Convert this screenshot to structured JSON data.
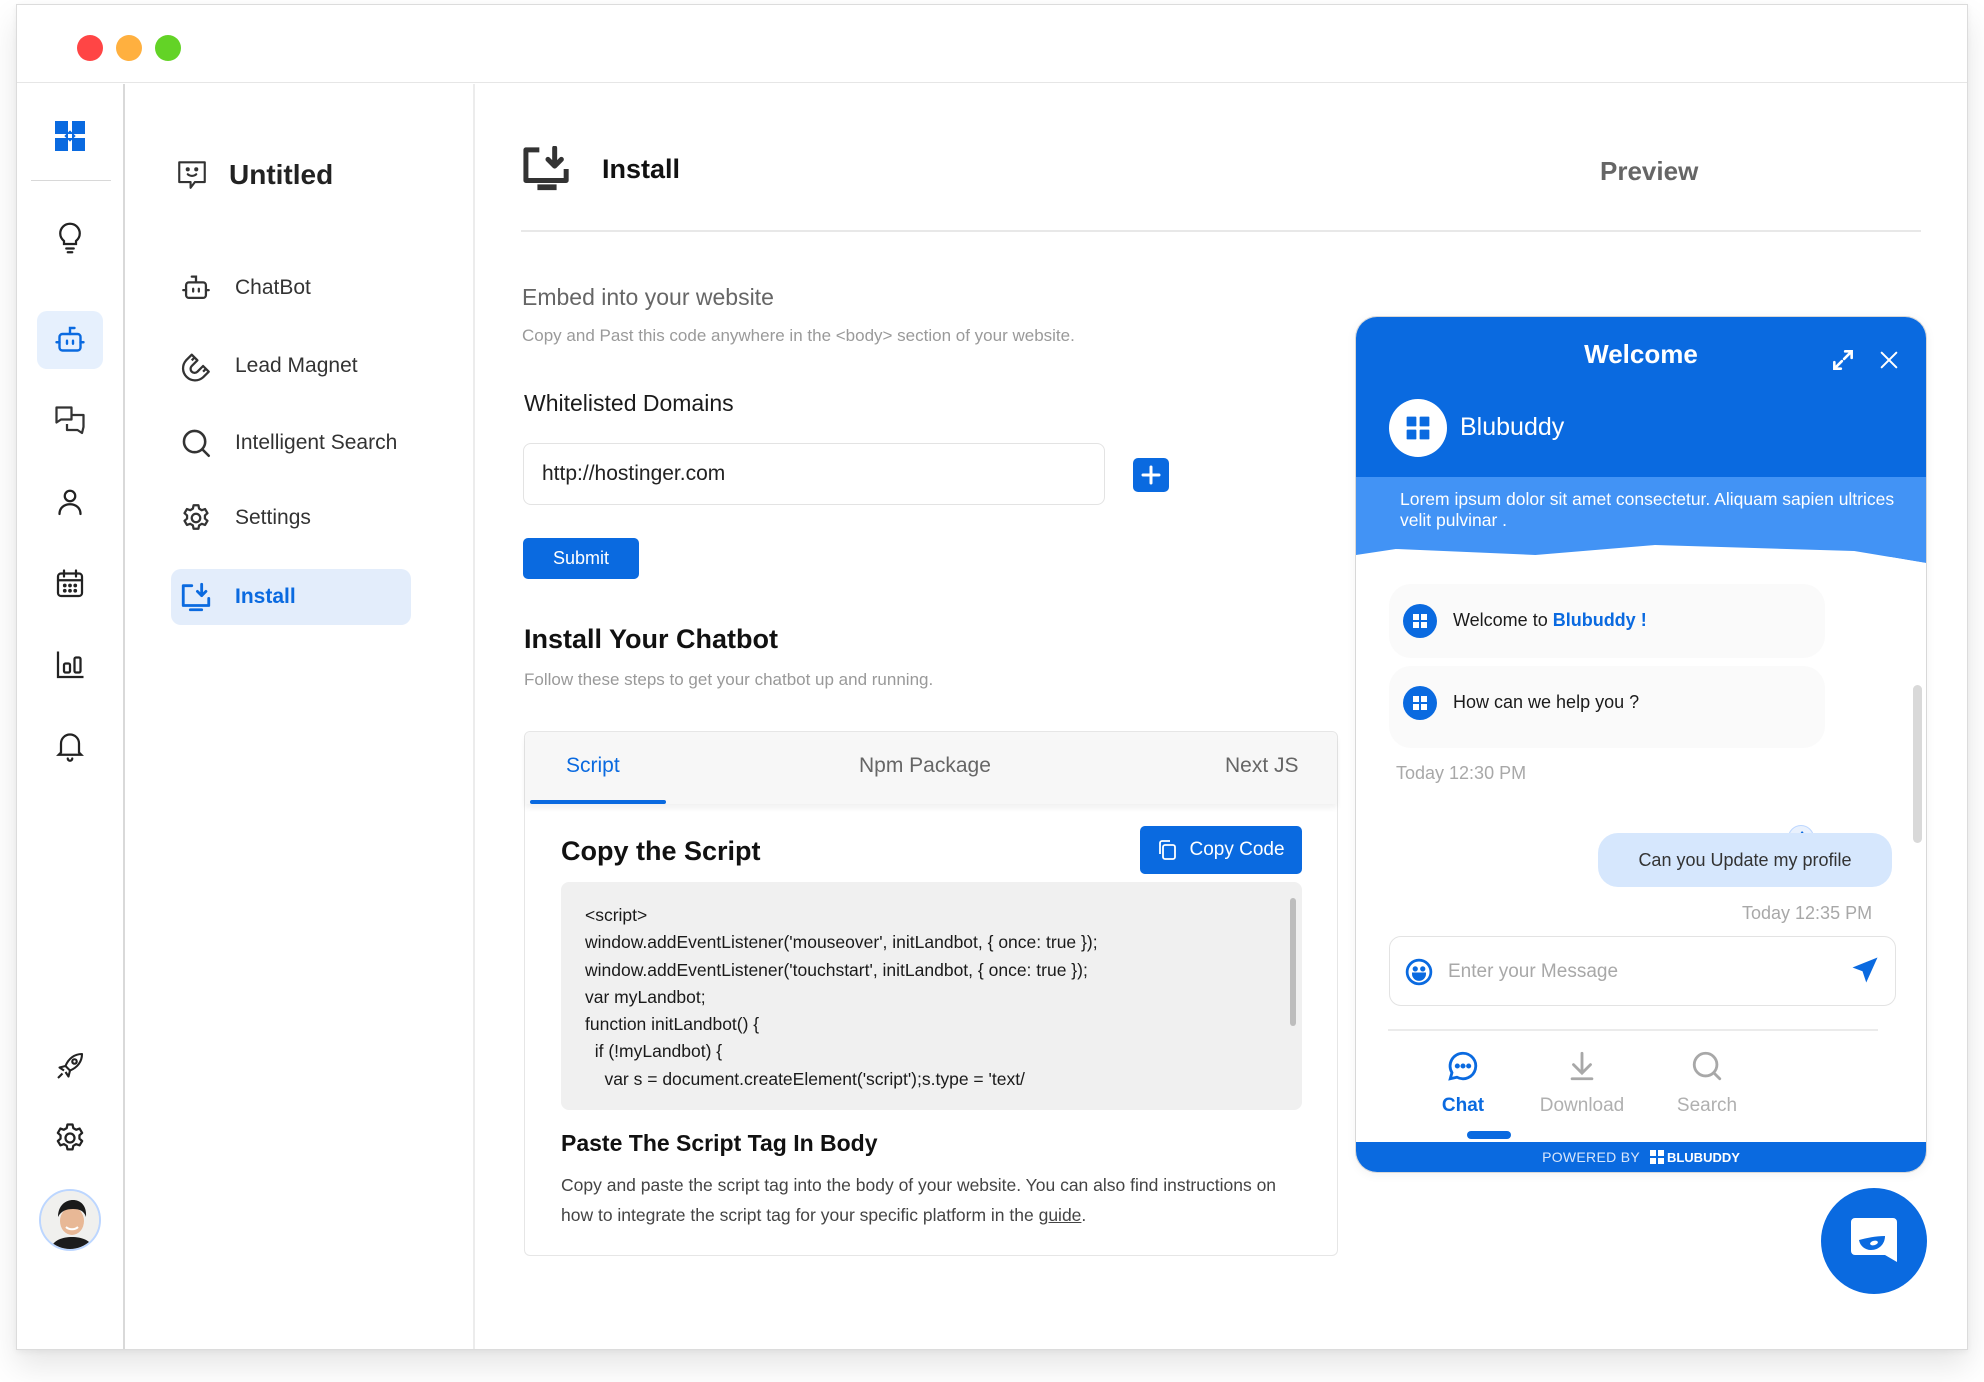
{
  "window": {
    "controls": [
      "close",
      "minimize",
      "maximize"
    ]
  },
  "rail": {
    "logo": "blubuddy-logo-icon",
    "items": [
      {
        "icon": "lightbulb-icon",
        "active": false
      },
      {
        "icon": "robot-icon",
        "active": true
      },
      {
        "icon": "chat-bubbles-icon",
        "active": false
      },
      {
        "icon": "user-icon",
        "active": false
      },
      {
        "icon": "calendar-icon",
        "active": false
      },
      {
        "icon": "bar-chart-icon",
        "active": false
      },
      {
        "icon": "bell-icon",
        "active": false
      }
    ],
    "bottom_items": [
      {
        "icon": "rocket-icon"
      },
      {
        "icon": "gear-icon"
      }
    ],
    "avatar": "user-avatar"
  },
  "subnav": {
    "title": "Untitled",
    "items": [
      {
        "label": "ChatBot",
        "icon": "robot-icon",
        "active": false
      },
      {
        "label": "Lead Magnet",
        "icon": "magnet-icon",
        "active": false
      },
      {
        "label": "Intelligent Search",
        "icon": "search-icon",
        "active": false
      },
      {
        "label": "Settings",
        "icon": "gear-icon",
        "active": false
      },
      {
        "label": "Install",
        "icon": "install-icon",
        "active": true
      }
    ]
  },
  "header": {
    "title": "Install",
    "preview_label": "Preview"
  },
  "embed": {
    "title": "Embed into your website",
    "subtitle": "Copy and Past this code anywhere in the <body> section of your website."
  },
  "whitelist": {
    "title": "Whitelisted Domains",
    "domain_value": "http://hostinger.com",
    "submit_label": "Submit"
  },
  "install": {
    "title": "Install Your Chatbot",
    "subtitle": "Follow these steps to get your chatbot up and running.",
    "tabs": [
      {
        "label": "Script",
        "active": true
      },
      {
        "label": "Npm Package",
        "active": false
      },
      {
        "label": "Next JS",
        "active": false
      }
    ],
    "copy_title": "Copy the Script",
    "copy_button": "Copy Code",
    "code_lines": [
      "<script>",
      "window.addEventListener('mouseover', initLandbot, { once: true });",
      "window.addEventListener('touchstart', initLandbot, { once: true });",
      "var myLandbot;",
      "function initLandbot() {",
      "  if (!myLandbot) {",
      "    var s = document.createElement('script');s.type = 'text/"
    ],
    "paste_title": "Paste The Script Tag In Body",
    "paste_text": "Copy and paste the script tag into the body of your website. You can also find instructions on how to integrate the script tag for your specific platform in the ",
    "paste_link": "guide",
    "paste_end": "."
  },
  "widget": {
    "title": "Welcome",
    "brand_name": "Blubuddy",
    "banner_text": "Lorem ipsum dolor sit amet consectetur. Aliquam sapien ultrices velit pulvinar .",
    "bot_messages": [
      {
        "prefix": "Welcome to ",
        "highlight": "Blubuddy !"
      },
      {
        "text": "How can we help you ?"
      }
    ],
    "bot_timestamp": "Today 12:30 PM",
    "user_message": "Can you Update my profile",
    "user_timestamp": "Today 12:35 PM",
    "input_placeholder": "Enter your Message",
    "tabs": [
      {
        "label": "Chat",
        "icon": "chat-icon",
        "active": true
      },
      {
        "label": "Download",
        "icon": "download-icon",
        "active": false
      },
      {
        "label": "Search",
        "icon": "search-icon",
        "active": false
      }
    ],
    "powered_by": "POWERED BY",
    "powered_brand": "BLUBUDDY"
  },
  "colors": {
    "accent": "#0a6ae0",
    "accent_light": "#e3edfb",
    "banner": "#4293f5",
    "user_bubble": "#d6e7fd"
  }
}
